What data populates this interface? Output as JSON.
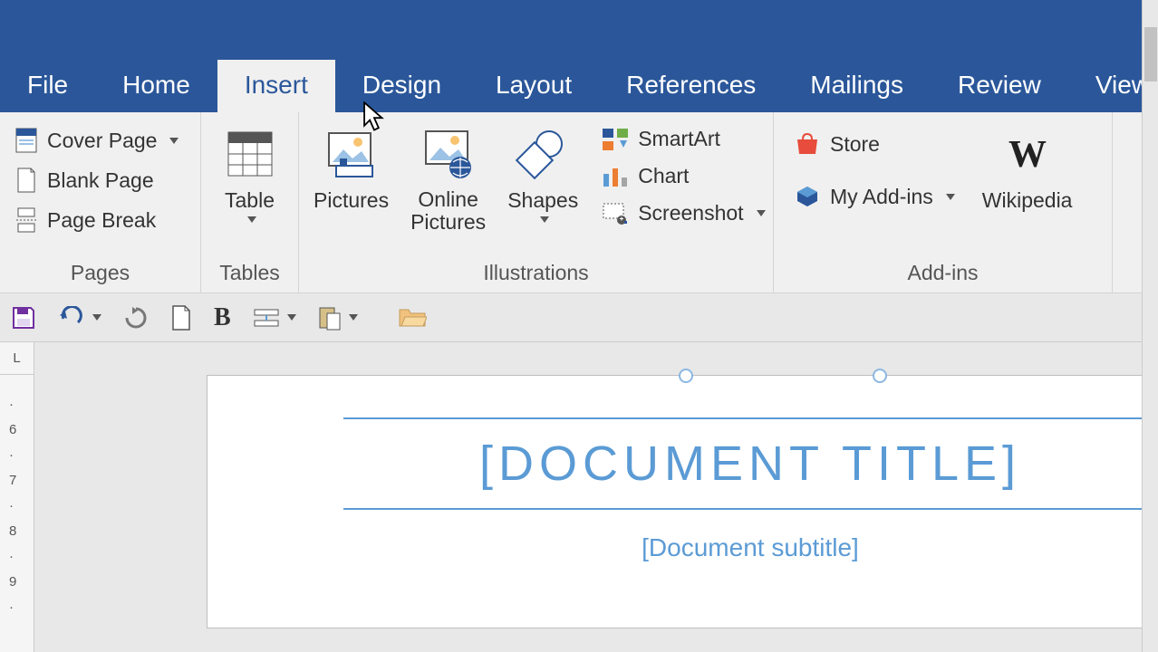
{
  "tabs": {
    "file": "File",
    "home": "Home",
    "insert": "Insert",
    "design": "Design",
    "layout": "Layout",
    "references": "References",
    "mailings": "Mailings",
    "review": "Review",
    "view": "View"
  },
  "ribbon": {
    "pages": {
      "label": "Pages",
      "cover": "Cover Page",
      "blank": "Blank Page",
      "break": "Page Break"
    },
    "tables": {
      "label": "Tables",
      "table": "Table"
    },
    "illustrations": {
      "label": "Illustrations",
      "pictures": "Pictures",
      "online": "Online\nPictures",
      "shapes": "Shapes",
      "smartart": "SmartArt",
      "chart": "Chart",
      "screenshot": "Screenshot"
    },
    "addins": {
      "label": "Add-ins",
      "store": "Store",
      "myaddins": "My Add-ins",
      "wikipedia": "Wikipedia"
    }
  },
  "ruler": {
    "corner": "L",
    "t1": "6",
    "t2": "7",
    "t3": "8",
    "t4": "9"
  },
  "doc": {
    "title": "[DOCUMENT TITLE]",
    "subtitle": "[Document subtitle]"
  }
}
